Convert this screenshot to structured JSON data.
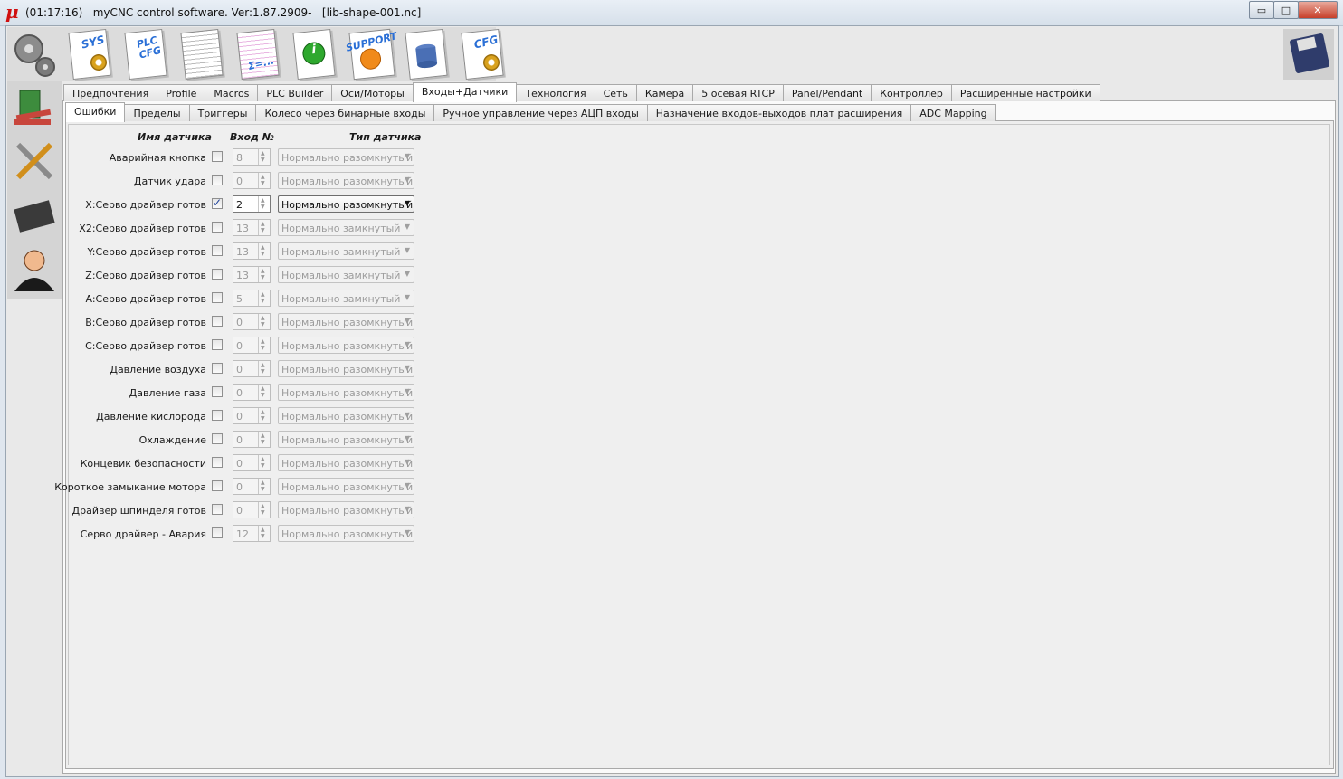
{
  "titlebar": {
    "app_glyph": "μ",
    "title": "(01:17:16)   myCNC control software. Ver:1.87.2909-   [lib-shape-001.nc]",
    "minimize": "▭",
    "maximize": "□",
    "close": "✕"
  },
  "toolbar": {
    "tools": [
      {
        "label": "SYS",
        "icon": "sys-gear-icon"
      },
      {
        "label": "PLC CFG",
        "icon": "plc-cfg-icon"
      },
      {
        "label": "",
        "icon": "document-list-icon"
      },
      {
        "label": "Σ=...",
        "icon": "formula-doc-icon"
      },
      {
        "label": "i",
        "icon": "info-icon"
      },
      {
        "label": "SUPPORT",
        "icon": "support-icon"
      },
      {
        "label": "",
        "icon": "database-icon"
      },
      {
        "label": "CFG",
        "icon": "cfg-gear-icon"
      }
    ],
    "save_icon": "floppy-disk-icon"
  },
  "sidebar": {
    "items": [
      "gears-icon",
      "books-icon",
      "tools-icon",
      "chip-icon",
      "user-icon"
    ]
  },
  "tabs_main": [
    "Предпочтения",
    "Profile",
    "Macros",
    "PLC Builder",
    "Оси/Моторы",
    "Входы+Датчики",
    "Технология",
    "Сеть",
    "Камера",
    "5 осевая RTCP",
    "Panel/Pendant",
    "Контроллер",
    "Расширенные настройки"
  ],
  "tabs_main_active": "Входы+Датчики",
  "tabs_sub": [
    "Ошибки",
    "Пределы",
    "Триггеры",
    "Колесо через бинарные входы",
    "Ручное управление через АЦП входы",
    "Назначение входов-выходов плат расширения",
    "ADC Mapping"
  ],
  "tabs_sub_active": "Ошибки",
  "form": {
    "headers": {
      "name": "Имя датчика",
      "input": "Вход №",
      "type": "Тип датчика"
    },
    "rows": [
      {
        "label": "Аварийная кнопка",
        "checked": false,
        "input": "8",
        "type": "Нормально разомкнутый"
      },
      {
        "label": "Датчик удара",
        "checked": false,
        "input": "0",
        "type": "Нормально разомкнутый"
      },
      {
        "label": "X:Серво драйвер готов",
        "checked": true,
        "input": "2",
        "type": "Нормально разомкнутый"
      },
      {
        "label": "X2:Серво драйвер готов",
        "checked": false,
        "input": "13",
        "type": "Нормально замкнутый"
      },
      {
        "label": "Y:Серво драйвер готов",
        "checked": false,
        "input": "13",
        "type": "Нормально замкнутый"
      },
      {
        "label": "Z:Серво драйвер готов",
        "checked": false,
        "input": "13",
        "type": "Нормально замкнутый"
      },
      {
        "label": "A:Серво драйвер готов",
        "checked": false,
        "input": "5",
        "type": "Нормально замкнутый"
      },
      {
        "label": "B:Серво драйвер готов",
        "checked": false,
        "input": "0",
        "type": "Нормально разомкнутый"
      },
      {
        "label": "C:Серво драйвер готов",
        "checked": false,
        "input": "0",
        "type": "Нормально разомкнутый"
      },
      {
        "label": "Давление воздуха",
        "checked": false,
        "input": "0",
        "type": "Нормально разомкнутый"
      },
      {
        "label": "Давление газа",
        "checked": false,
        "input": "0",
        "type": "Нормально разомкнутый"
      },
      {
        "label": "Давление кислорода",
        "checked": false,
        "input": "0",
        "type": "Нормально разомкнутый"
      },
      {
        "label": "Охлаждение",
        "checked": false,
        "input": "0",
        "type": "Нормально разомкнутый"
      },
      {
        "label": "Концевик безопасности",
        "checked": false,
        "input": "0",
        "type": "Нормально разомкнутый"
      },
      {
        "label": "Короткое замыкание мотора",
        "checked": false,
        "input": "0",
        "type": "Нормально разомкнутый"
      },
      {
        "label": "Драйвер шпинделя готов",
        "checked": false,
        "input": "0",
        "type": "Нормально разомкнутый"
      },
      {
        "label": "Серво драйвер - Авария",
        "checked": false,
        "input": "12",
        "type": "Нормально разомкнутый"
      }
    ]
  }
}
